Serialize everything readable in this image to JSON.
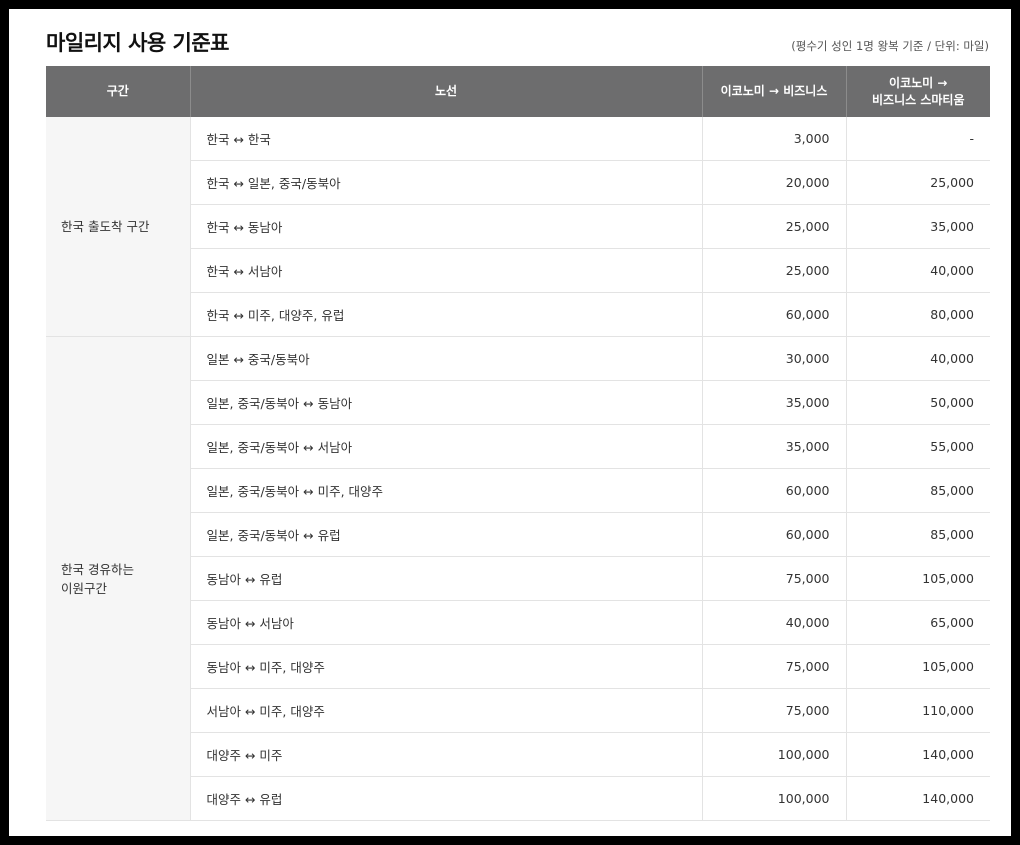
{
  "title": "마일리지 사용 기준표",
  "note": "(평수기 성인 1명 왕복 기준 / 단위: 마일)",
  "headers": {
    "section": "구간",
    "route": "노선",
    "business": "이코노미 → 비즈니스",
    "prestige_line1": "이코노미 →",
    "prestige_line2": "비즈니스 스마티움"
  },
  "groups": [
    {
      "section_line1": "한국 출도착 구간",
      "section_line2": "",
      "rows": [
        {
          "route": "한국 ↔ 한국",
          "business": "3,000",
          "prestige": "-"
        },
        {
          "route": "한국 ↔ 일본, 중국/동북아",
          "business": "20,000",
          "prestige": "25,000"
        },
        {
          "route": "한국 ↔ 동남아",
          "business": "25,000",
          "prestige": "35,000"
        },
        {
          "route": "한국 ↔ 서남아",
          "business": "25,000",
          "prestige": "40,000"
        },
        {
          "route": "한국 ↔ 미주, 대양주, 유럽",
          "business": "60,000",
          "prestige": "80,000"
        }
      ]
    },
    {
      "section_line1": "한국 경유하는",
      "section_line2": "이원구간",
      "rows": [
        {
          "route": "일본 ↔ 중국/동북아",
          "business": "30,000",
          "prestige": "40,000"
        },
        {
          "route": "일본, 중국/동북아 ↔ 동남아",
          "business": "35,000",
          "prestige": "50,000"
        },
        {
          "route": "일본, 중국/동북아 ↔ 서남아",
          "business": "35,000",
          "prestige": "55,000"
        },
        {
          "route": "일본, 중국/동북아 ↔ 미주, 대양주",
          "business": "60,000",
          "prestige": "85,000"
        },
        {
          "route": "일본, 중국/동북아 ↔ 유럽",
          "business": "60,000",
          "prestige": "85,000"
        },
        {
          "route": "동남아 ↔ 유럽",
          "business": "75,000",
          "prestige": "105,000"
        },
        {
          "route": "동남아 ↔ 서남아",
          "business": "40,000",
          "prestige": "65,000"
        },
        {
          "route": "동남아 ↔ 미주, 대양주",
          "business": "75,000",
          "prestige": "105,000"
        },
        {
          "route": "서남아 ↔ 미주, 대양주",
          "business": "75,000",
          "prestige": "110,000"
        },
        {
          "route": "대양주 ↔ 미주",
          "business": "100,000",
          "prestige": "140,000"
        },
        {
          "route": "대양주 ↔ 유럽",
          "business": "100,000",
          "prestige": "140,000"
        }
      ]
    }
  ]
}
